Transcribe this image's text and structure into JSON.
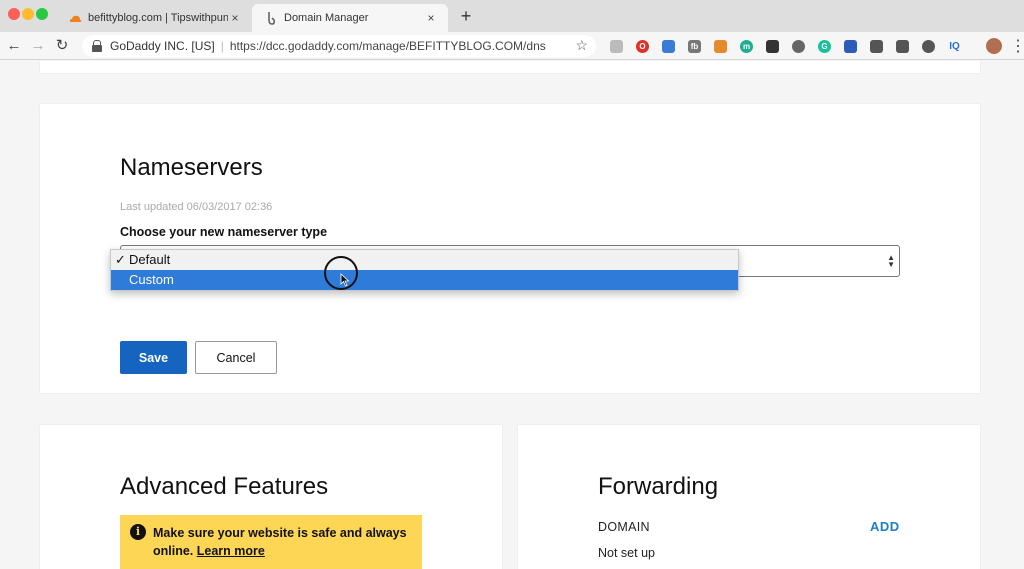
{
  "browser": {
    "tabs": [
      {
        "title": "befittyblog.com | Tipswithpun",
        "favicon": "cloudflare-icon",
        "close": "×"
      },
      {
        "title": "Domain Manager",
        "favicon": "godaddy-icon",
        "close": "×"
      }
    ],
    "new_tab": "+",
    "nav": {
      "back": "←",
      "forward": "→",
      "reload": "↻"
    },
    "org": "GoDaddy INC. [US]",
    "url": "https://dcc.godaddy.com/manage/BEFITTYBLOG.COM/dns",
    "star": "☆",
    "extensions": [
      {
        "icon": "ghostery-icon",
        "label": "",
        "color": "#bbbbbb"
      },
      {
        "icon": "opera-icon",
        "label": "O",
        "color": "#e0302a"
      },
      {
        "icon": "cast-icon",
        "label": "",
        "color": "#3a7bd5"
      },
      {
        "icon": "fb-icon",
        "label": "fb",
        "color": "#777777"
      },
      {
        "icon": "coupon-icon",
        "label": "",
        "color": "#e68a2e"
      },
      {
        "icon": "mercury-icon",
        "label": "m",
        "color": "#1fae8f"
      },
      {
        "icon": "dark-ext-icon",
        "label": "",
        "color": "#333333"
      },
      {
        "icon": "circle-ext-icon",
        "label": "",
        "color": "#666666"
      },
      {
        "icon": "grammarly-icon",
        "label": "G",
        "color": "#15c39a"
      },
      {
        "icon": "puzzle-icon",
        "label": "",
        "color": "#2d5bb8"
      },
      {
        "icon": "camera-icon",
        "label": "",
        "color": "#555555"
      },
      {
        "icon": "screen-icon",
        "label": "",
        "color": "#555555"
      },
      {
        "icon": "globe-icon",
        "label": "",
        "color": "#555555"
      },
      {
        "icon": "iq-icon",
        "label": "IQ",
        "color": "#2a6fd6"
      }
    ],
    "menu": "⋮"
  },
  "nameservers": {
    "title": "Nameservers",
    "last_updated": "Last updated 06/03/2017 02:36",
    "choose_label": "Choose your new nameserver type",
    "select_arrows": "▲▼",
    "options": [
      {
        "check": "✓",
        "label": "Default",
        "selected": true
      },
      {
        "check": "",
        "label": "Custom",
        "highlighted": true
      }
    ],
    "save": "Save",
    "cancel": "Cancel"
  },
  "advanced": {
    "title": "Advanced Features",
    "info_icon": "i",
    "banner_text": "Make sure your website is safe and always online.",
    "learn_more": "Learn more"
  },
  "forwarding": {
    "title": "Forwarding",
    "domain_label": "DOMAIN",
    "add": "ADD",
    "status": "Not set up"
  },
  "colors": {
    "primary_button": "#1565c0",
    "highlight": "#2f7bd9",
    "banner": "#fdd656",
    "link_blue": "#1d7fc6"
  }
}
